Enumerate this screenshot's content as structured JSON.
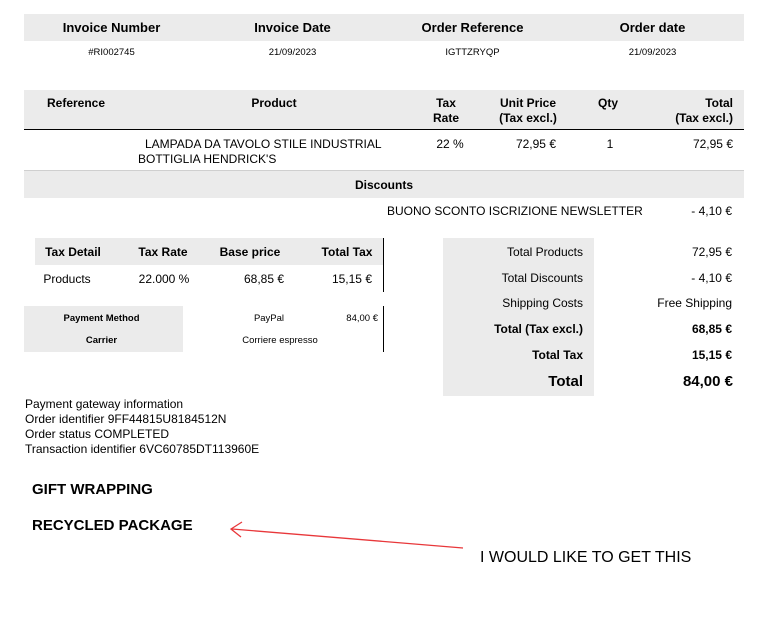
{
  "header": {
    "invoice_number_label": "Invoice Number",
    "invoice_date_label": "Invoice Date",
    "order_reference_label": "Order Reference",
    "order_date_label": "Order date",
    "invoice_number": "#RI002745",
    "invoice_date": "21/09/2023",
    "order_reference": "IGTTZRYQP",
    "order_date": "21/09/2023"
  },
  "products_table": {
    "headers": {
      "reference": "Reference",
      "product": "Product",
      "tax_rate_1": "Tax",
      "tax_rate_2": "Rate",
      "unit_price_1": "Unit Price",
      "unit_price_2": "(Tax excl.)",
      "qty": "Qty",
      "total_1": "Total",
      "total_2": "(Tax excl.)"
    },
    "rows": [
      {
        "reference": "",
        "product_line_1": "LAMPADA DA TAVOLO STILE INDUSTRIAL",
        "product_line_2": "BOTTIGLIA HENDRICK'S",
        "tax_rate": "22 %",
        "unit_price": "72,95 €",
        "qty": "1",
        "total": "72,95 €"
      }
    ]
  },
  "discounts": {
    "title": "Discounts",
    "items": [
      {
        "name": "BUONO SCONTO ISCRIZIONE NEWSLETTER",
        "amount": "- 4,10 €"
      }
    ]
  },
  "tax_detail": {
    "headers": {
      "detail": "Tax Detail",
      "rate": "Tax Rate",
      "base": "Base price",
      "total": "Total Tax"
    },
    "rows": [
      {
        "detail": "Products",
        "rate": "22.000 %",
        "base": "68,85 €",
        "total": "15,15 €"
      }
    ]
  },
  "payment": {
    "method_label": "Payment Method",
    "method_value": "PayPal",
    "method_amount": "84,00 €",
    "carrier_label": "Carrier",
    "carrier_value": "Corriere espresso"
  },
  "totals": {
    "products_label": "Total Products",
    "products_value": "72,95 €",
    "discounts_label": "Total Discounts",
    "discounts_value": "- 4,10 €",
    "shipping_label": "Shipping Costs",
    "shipping_value": "Free Shipping",
    "tax_excl_label": "Total (Tax excl.)",
    "tax_excl_value": "68,85 €",
    "tax_label": "Total Tax",
    "tax_value": "15,15 €",
    "total_label": "Total",
    "total_value": "84,00 €"
  },
  "gateway": {
    "line1": "Payment gateway information",
    "line2": "Order identifier 9FF44815U8184512N",
    "line3": "Order status COMPLETED",
    "line4": "Transaction identifier 6VC60785DT113960E"
  },
  "extras": {
    "gift_wrapping": "GIFT WRAPPING",
    "recycled_package": "RECYCLED PACKAGE",
    "annotation": "I WOULD LIKE TO GET THIS",
    "annotation_color": "#e8373a"
  }
}
